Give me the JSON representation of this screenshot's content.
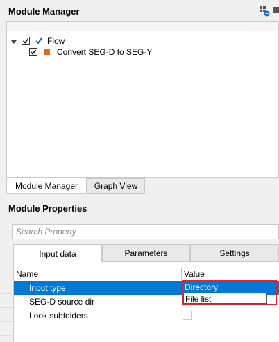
{
  "module_manager": {
    "title": "Module Manager",
    "icons": [
      "add-module-icon",
      "module-icon"
    ],
    "tree": [
      {
        "label": "Flow",
        "checked": true,
        "expanded": true,
        "icon": "checkmark-icon",
        "icon_color": "#1a5fb4"
      },
      {
        "label": "Convert SEG-D to SEG-Y",
        "checked": true,
        "icon": "module-square-icon",
        "icon_color": "#e06a1b"
      }
    ],
    "tabs": [
      "Module Manager",
      "Graph View"
    ]
  },
  "module_properties": {
    "title": "Module Properties",
    "search_placeholder": "Search Property",
    "tabs": [
      "Input data",
      "Parameters",
      "Settings"
    ],
    "columns": {
      "name": "Name",
      "value": "Value"
    },
    "rows": [
      {
        "name": "Input type",
        "selected": true
      },
      {
        "name": "SEG-D source dir"
      },
      {
        "name": "Look subfolders",
        "checkbox": false
      }
    ],
    "dropdown": {
      "options": [
        "Directory",
        "File list"
      ],
      "highlighted": "Directory"
    }
  },
  "colors": {
    "selection": "#0078d7",
    "highlight_border": "#d9282f"
  }
}
